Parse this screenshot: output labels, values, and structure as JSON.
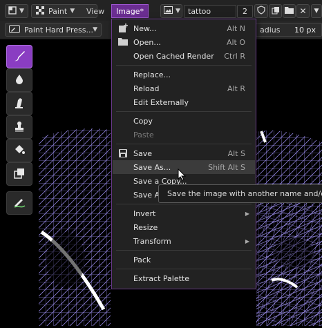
{
  "topbar": {
    "paint_mode": "Paint",
    "view_menu": "View",
    "image_menu": "Image*",
    "document_name": "tattoo",
    "count_value": "2"
  },
  "toolbar2": {
    "brush_preset": "Paint Hard Press...",
    "radius_label": "adius",
    "radius_value": "10 px"
  },
  "menu": {
    "items": [
      {
        "label": "New...",
        "shortcut": "Alt N",
        "icon": "new-image-icon"
      },
      {
        "label": "Open...",
        "shortcut": "Alt O",
        "icon": "folder-icon"
      },
      {
        "label": "Open Cached Render",
        "shortcut": "Ctrl R"
      },
      {
        "label": "Replace...",
        "shortcut": ""
      },
      {
        "label": "Reload",
        "shortcut": "Alt R"
      },
      {
        "label": "Edit Externally",
        "shortcut": ""
      },
      {
        "label": "Copy",
        "shortcut": ""
      },
      {
        "label": "Paste",
        "shortcut": "",
        "disabled": true
      },
      {
        "label": "Save",
        "shortcut": "Alt S",
        "icon": "save-icon"
      },
      {
        "label": "Save As...",
        "shortcut": "Shift Alt S"
      },
      {
        "label": "Save a Copy...",
        "shortcut": ""
      },
      {
        "label": "Save A",
        "shortcut": ""
      },
      {
        "label": "Invert",
        "shortcut": "",
        "submenu": true
      },
      {
        "label": "Resize",
        "shortcut": ""
      },
      {
        "label": "Transform",
        "shortcut": "",
        "submenu": true
      },
      {
        "label": "Pack",
        "shortcut": ""
      },
      {
        "label": "Extract Palette",
        "shortcut": ""
      }
    ]
  },
  "tooltip": {
    "text": "Save the image with another name and/or s"
  },
  "colors": {
    "accent": "#8a3dc2",
    "menu_border": "#6a3a8c",
    "mesh": "#8c7fd8"
  },
  "tools": [
    "paint-brush-icon",
    "blur-drop-icon",
    "smudge-icon",
    "clone-stamp-icon",
    "fill-bucket-icon",
    "layers-icon",
    "line-pen-icon"
  ]
}
